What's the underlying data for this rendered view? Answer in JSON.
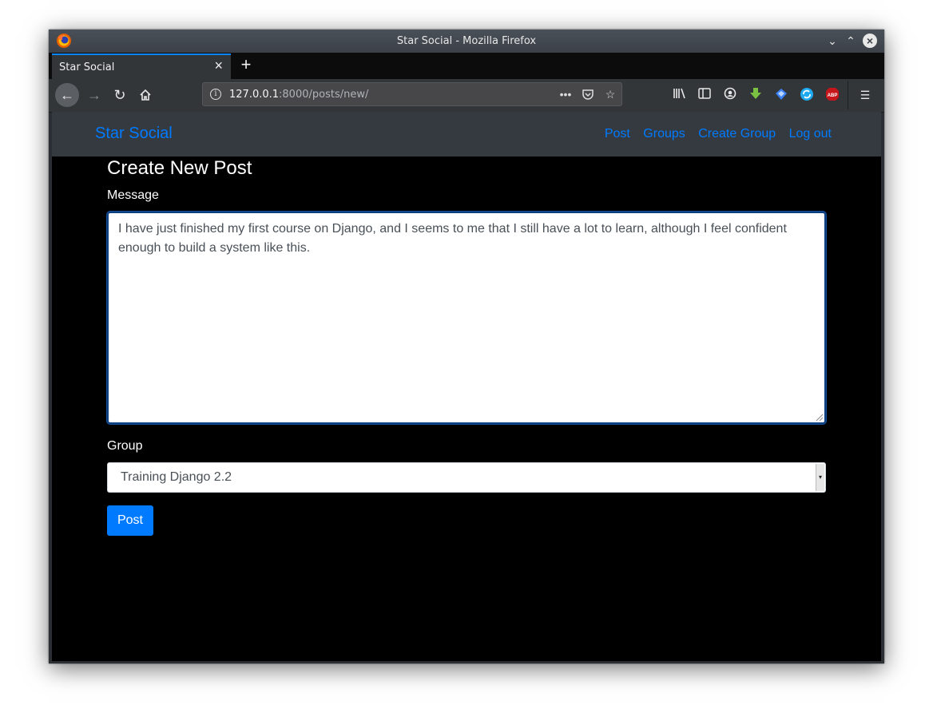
{
  "window": {
    "title": "Star Social - Mozilla Firefox"
  },
  "tab": {
    "label": "Star Social"
  },
  "urlbar": {
    "host": "127.0.0.1",
    "rest": ":8000/posts/new/"
  },
  "site": {
    "brand": "Star Social",
    "nav": {
      "post": "Post",
      "groups": "Groups",
      "create_group": "Create Group",
      "logout": "Log out"
    }
  },
  "form": {
    "heading": "Create New Post",
    "message_label": "Message",
    "message_value": "I have just finished my first course on Django, and I seems to me that I still have a lot to learn, although I feel confident enough to build a system like this.",
    "group_label": "Group",
    "group_selected": "Training Django 2.2",
    "submit_label": "Post"
  },
  "colors": {
    "accent": "#007bff",
    "navbar_bg": "#343a40",
    "page_bg": "#000000"
  }
}
